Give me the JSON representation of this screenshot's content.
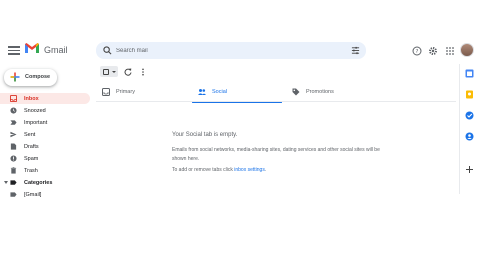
{
  "header": {
    "app_name": "Gmail",
    "search_placeholder": "Search mail"
  },
  "sidebar": {
    "compose_label": "Compose",
    "items": [
      {
        "label": "Inbox",
        "icon": "inbox-icon",
        "active": true
      },
      {
        "label": "Snoozed",
        "icon": "clock-icon"
      },
      {
        "label": "Important",
        "icon": "label-important-icon"
      },
      {
        "label": "Sent",
        "icon": "send-icon"
      },
      {
        "label": "Drafts",
        "icon": "draft-icon"
      },
      {
        "label": "Spam",
        "icon": "spam-icon"
      },
      {
        "label": "Trash",
        "icon": "trash-icon"
      },
      {
        "label": "Categories",
        "icon": "label-icon",
        "bold": true
      },
      {
        "label": "[Gmail]",
        "icon": "label-icon"
      }
    ]
  },
  "tabs": [
    {
      "label": "Primary",
      "icon": "inbox-icon"
    },
    {
      "label": "Social",
      "icon": "people-icon",
      "active": true
    },
    {
      "label": "Promotions",
      "icon": "tag-icon"
    }
  ],
  "empty_state": {
    "title": "Your Social tab is empty.",
    "description": "Emails from social networks, media-sharing sites, dating services and other social sites will be shown here.",
    "hint_prefix": "To add or remove tabs click ",
    "hint_link": "inbox settings",
    "hint_suffix": "."
  },
  "colors": {
    "accent_blue": "#1a73e8",
    "inbox_active_bg": "#fce8e6",
    "inbox_active_text": "#d93025",
    "search_bg": "#eaf1fb"
  },
  "right_panel_icons": [
    "calendar-icon",
    "keep-icon",
    "tasks-icon",
    "contacts-icon",
    "add-icon"
  ]
}
